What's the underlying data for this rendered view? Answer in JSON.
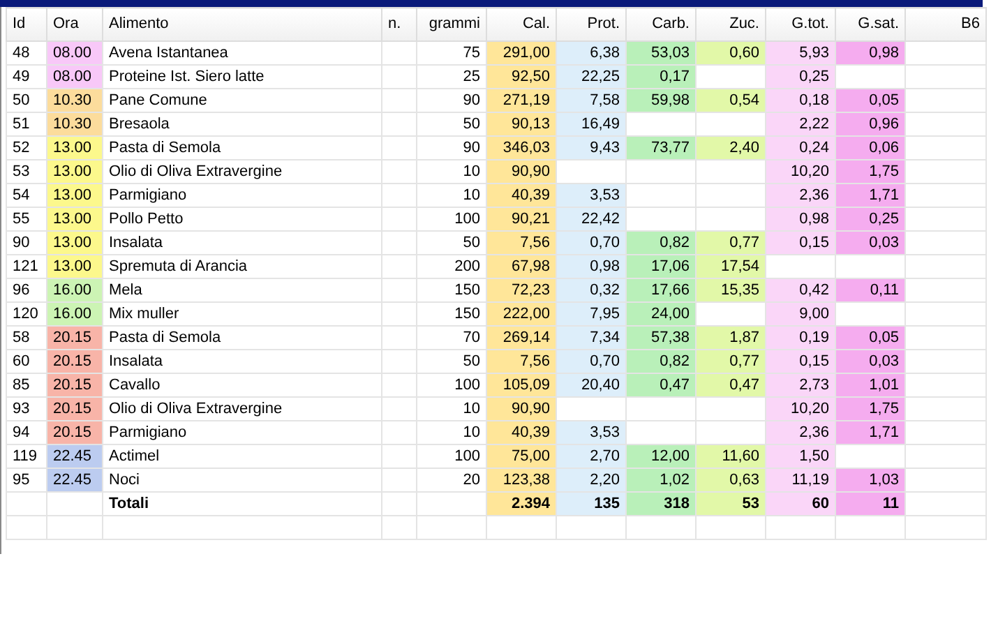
{
  "table": {
    "columns": [
      "Id",
      "Ora",
      "Alimento",
      "n.",
      "grammi",
      "Cal.",
      "Prot.",
      "Carb.",
      "Zuc.",
      "G.tot.",
      "G.sat.",
      "B6"
    ],
    "rows": [
      {
        "id": "48",
        "ora": "08.00",
        "color": "#f8c8f8",
        "alimento": "Avena Istantanea",
        "grammi": "75",
        "cal": "291,00",
        "prot": "6,38",
        "carb": "53,03",
        "zuc": "0,60",
        "g_tot": "5,93",
        "g_sat": "0,98"
      },
      {
        "id": "49",
        "ora": "08.00",
        "color": "#f8c8f8",
        "alimento": "Proteine Ist. Siero latte",
        "grammi": "25",
        "cal": "92,50",
        "prot": "22,25",
        "carb": "0,17",
        "g_tot": "0,25"
      },
      {
        "id": "50",
        "ora": "10.30",
        "color": "#fcdc9c",
        "alimento": "Pane Comune",
        "grammi": "90",
        "cal": "271,19",
        "prot": "7,58",
        "carb": "59,98",
        "zuc": "0,54",
        "g_tot": "0,18",
        "g_sat": "0,05"
      },
      {
        "id": "51",
        "ora": "10.30",
        "color": "#fcdc9c",
        "alimento": "Bresaola",
        "grammi": "50",
        "cal": "90,13",
        "prot": "16,49",
        "g_tot": "2,22",
        "g_sat": "0,96"
      },
      {
        "id": "52",
        "ora": "13.00",
        "color": "#fcf88c",
        "alimento": "Pasta di Semola",
        "grammi": "90",
        "cal": "346,03",
        "prot": "9,43",
        "carb": "73,77",
        "zuc": "2,40",
        "g_tot": "0,24",
        "g_sat": "0,06"
      },
      {
        "id": "53",
        "ora": "13.00",
        "color": "#fcf88c",
        "alimento": "Olio di Oliva Extravergine",
        "grammi": "10",
        "cal": "90,90",
        "g_tot": "10,20",
        "g_sat": "1,75"
      },
      {
        "id": "54",
        "ora": "13.00",
        "color": "#fcf88c",
        "alimento": "Parmigiano",
        "grammi": "10",
        "cal": "40,39",
        "prot": "3,53",
        "g_tot": "2,36",
        "g_sat": "1,71"
      },
      {
        "id": "55",
        "ora": "13.00",
        "color": "#fcf88c",
        "alimento": "Pollo Petto",
        "grammi": "100",
        "cal": "90,21",
        "prot": "22,42",
        "g_tot": "0,98",
        "g_sat": "0,25"
      },
      {
        "id": "90",
        "ora": "13.00",
        "color": "#fcf88c",
        "alimento": "Insalata",
        "grammi": "50",
        "cal": "7,56",
        "prot": "0,70",
        "carb": "0,82",
        "zuc": "0,77",
        "g_tot": "0,15",
        "g_sat": "0,03"
      },
      {
        "id": "121",
        "ora": "13.00",
        "color": "#fcf88c",
        "alimento": "Spremuta di Arancia",
        "grammi": "200",
        "cal": "67,98",
        "prot": "0,98",
        "carb": "17,06",
        "zuc": "17,54"
      },
      {
        "id": "96",
        "ora": "16.00",
        "color": "#ccf4b4",
        "alimento": "Mela",
        "grammi": "150",
        "cal": "72,23",
        "prot": "0,32",
        "carb": "17,66",
        "zuc": "15,35",
        "g_tot": "0,42",
        "g_sat": "0,11"
      },
      {
        "id": "120",
        "ora": "16.00",
        "color": "#ccf4b4",
        "alimento": "Mix muller",
        "grammi": "150",
        "cal": "222,00",
        "prot": "7,95",
        "carb": "24,00",
        "g_tot": "9,00"
      },
      {
        "id": "58",
        "ora": "20.15",
        "color": "#f8b4a8",
        "alimento": "Pasta di Semola",
        "grammi": "70",
        "cal": "269,14",
        "prot": "7,34",
        "carb": "57,38",
        "zuc": "1,87",
        "g_tot": "0,19",
        "g_sat": "0,05"
      },
      {
        "id": "60",
        "ora": "20.15",
        "color": "#f8b4a8",
        "alimento": "Insalata",
        "grammi": "50",
        "cal": "7,56",
        "prot": "0,70",
        "carb": "0,82",
        "zuc": "0,77",
        "g_tot": "0,15",
        "g_sat": "0,03"
      },
      {
        "id": "85",
        "ora": "20.15",
        "color": "#f8b4a8",
        "alimento": "Cavallo",
        "grammi": "100",
        "cal": "105,09",
        "prot": "20,40",
        "carb": "0,47",
        "zuc": "0,47",
        "g_tot": "2,73",
        "g_sat": "1,01"
      },
      {
        "id": "93",
        "ora": "20.15",
        "color": "#f8b4a8",
        "alimento": "Olio di Oliva Extravergine",
        "grammi": "10",
        "cal": "90,90",
        "g_tot": "10,20",
        "g_sat": "1,75"
      },
      {
        "id": "94",
        "ora": "20.15",
        "color": "#f8b4a8",
        "alimento": "Parmigiano",
        "grammi": "10",
        "cal": "40,39",
        "prot": "3,53",
        "g_tot": "2,36",
        "g_sat": "1,71"
      },
      {
        "id": "119",
        "ora": "22.45",
        "color": "#bcccf0",
        "alimento": "Actimel",
        "grammi": "100",
        "cal": "75,00",
        "prot": "2,70",
        "carb": "12,00",
        "zuc": "11,60",
        "g_tot": "1,50"
      },
      {
        "id": "95",
        "ora": "22.45",
        "color": "#bcccf0",
        "alimento": "Noci",
        "grammi": "20",
        "cal": "123,38",
        "prot": "2,20",
        "carb": "1,02",
        "zuc": "0,63",
        "g_tot": "11,19",
        "g_sat": "1,03"
      }
    ],
    "totals": {
      "label": "Totali",
      "cal": "2.394",
      "prot": "135",
      "carb": "318",
      "zuc": "53",
      "g_tot": "60",
      "g_sat": "11"
    }
  }
}
